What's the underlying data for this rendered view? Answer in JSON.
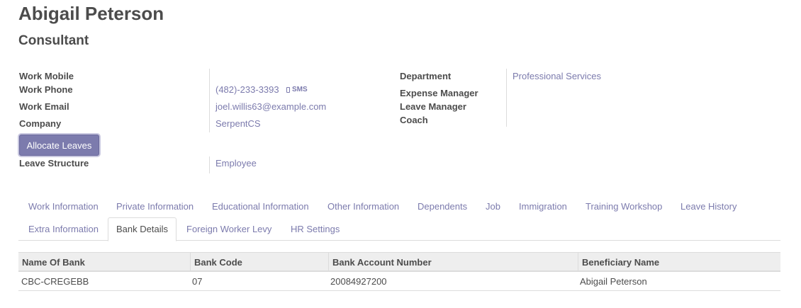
{
  "employee": {
    "name": "Abigail Peterson",
    "job_title": "Consultant"
  },
  "left_fields": {
    "work_mobile": {
      "label": "Work Mobile",
      "value": ""
    },
    "work_phone": {
      "label": "Work Phone",
      "value": "(482)-233-3393"
    },
    "work_email": {
      "label": "Work Email",
      "value": "joel.willis63@example.com"
    },
    "company": {
      "label": "Company",
      "value": "SerpentCS"
    },
    "leave_structure": {
      "label": "Leave Structure",
      "value": "Employee"
    }
  },
  "sms_label": "SMS",
  "sms_icon": "mobile-phone-icon",
  "right_fields": {
    "department": {
      "label": "Department",
      "value": "Professional Services"
    },
    "expense_manager": {
      "label": "Expense Manager",
      "value": ""
    },
    "leave_manager": {
      "label": "Leave Manager",
      "value": ""
    },
    "coach": {
      "label": "Coach",
      "value": ""
    }
  },
  "allocate_button": "Allocate Leaves",
  "tabs": [
    "Work Information",
    "Private Information",
    "Educational Information",
    "Other Information",
    "Dependents",
    "Job",
    "Immigration",
    "Training Workshop",
    "Leave History",
    "Extra Information",
    "Bank Details",
    "Foreign Worker Levy",
    "HR Settings"
  ],
  "active_tab": "Bank Details",
  "bank_table": {
    "headers": [
      "Name Of Bank",
      "Bank Code",
      "Bank Account Number",
      "Beneficiary Name"
    ],
    "rows": [
      [
        "CBC-CREGEBB",
        "07",
        "20084927200",
        "Abigail Peterson"
      ]
    ]
  },
  "colors": {
    "accent": "#7c7bad",
    "text": "#4c4c4c",
    "header_bg": "#eeeeee",
    "border": "#dcdcdc"
  }
}
